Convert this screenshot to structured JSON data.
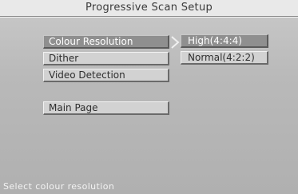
{
  "title": "Progressive Scan Setup",
  "menu": {
    "items": [
      {
        "label": "Colour Resolution",
        "selected": true
      },
      {
        "label": "Dither",
        "selected": false
      },
      {
        "label": "Video Detection",
        "selected": false
      },
      {
        "label": "Main Page",
        "selected": false
      }
    ]
  },
  "submenu": {
    "options": [
      {
        "label": "High(4:4:4)",
        "selected": true
      },
      {
        "label": "Normal(4:2:2)",
        "selected": false
      }
    ]
  },
  "status_text": "Select colour resolution",
  "colors": {
    "selected_background": "#8f8f8f",
    "button_background": "#d2d2d2",
    "screen_background": "#b9b9b9"
  }
}
